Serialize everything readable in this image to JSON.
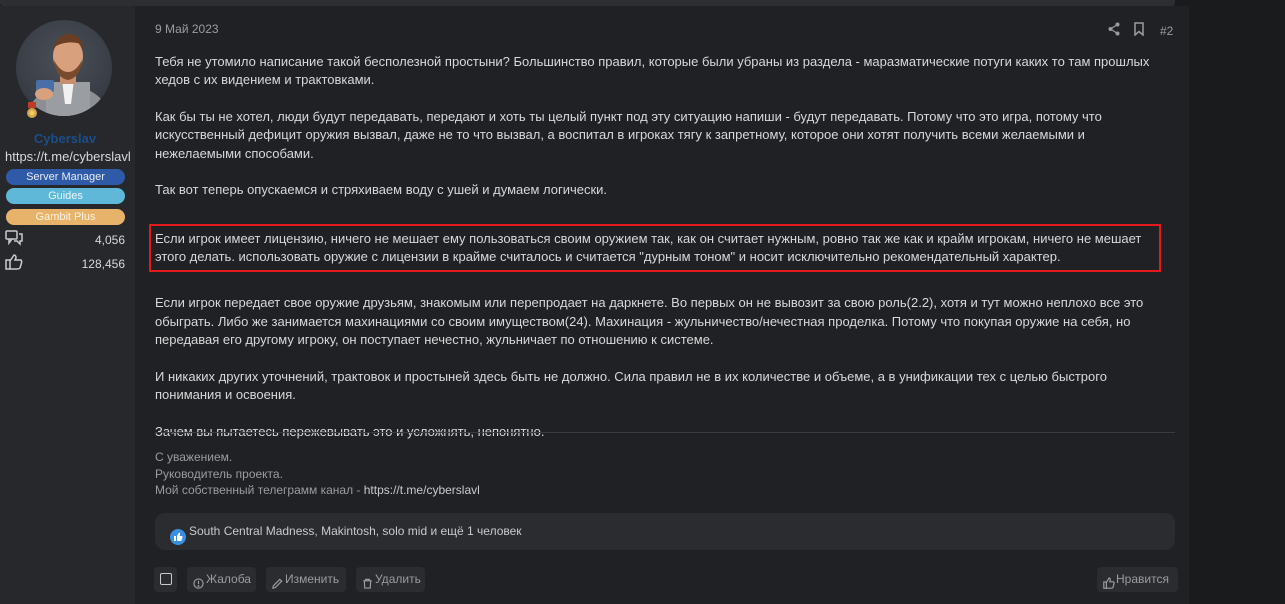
{
  "user": {
    "name": "Cyberslav",
    "link": "https://t.me/cyberslavl",
    "badges": [
      "Server Manager",
      "Guides",
      "Gambit Plus"
    ],
    "messages": "4,056",
    "reactions": "128,456"
  },
  "post": {
    "date": "9 Май 2023",
    "number": "#2",
    "paragraphs": [
      "Тебя не утомило написание такой бесполезной простыни? Большинство правил, которые были убраны из раздела - маразматические потуги каких то там прошлых хедов с их видением и трактовками.",
      "Как бы ты не хотел, люди будут передавать, передают и хоть ты целый пункт под эту ситуацию напиши - будут передавать. Потому что это игра, потому что искусственный дефицит оружия вызвал, даже не то что вызвал, а воспитал в игроках тягу к запретному, которое они хотят получить всеми желаемыми и нежелаемыми способами.",
      "Так вот теперь опускаемся и стряхиваем воду с ушей и думаем логически.",
      "Если игрок имеет лицензию, ничего не мешает ему пользоваться своим оружием так, как он считает нужным, ровно так же как и крайм игрокам, ничего не мешает этого делать. использовать оружие с лицензии в крайме считалось и считается \"дурным тоном\" и носит исключительно рекомендательный характер.",
      "Если игрок передает свое оружие друзьям, знакомым или перепродает на даркнете. Во первых он не вывозит за свою роль(2.2), хотя и тут можно неплохо все это обыграть. Либо же занимается махинациями со своим имуществом(24). Махинация - жульничество/нечестная проделка. Потому что покупая оружие на себя, но передавая его другому игроку, он поступает нечестно, жульничает по отношению к системе.",
      "И никаких других уточнений, трактовок и простыней здесь быть не должно. Сила правил не в их количестве и объеме, а в унификации тех с целью быстрого понимания и освоения.",
      "Зачем вы пытаетесь пережевывать это и усложнять, непонятно."
    ],
    "signature": {
      "line1": "С уважением.",
      "line2": "Руководитель проекта.",
      "line3_prefix": "Мой собственный телеграмм канал - ",
      "line3_link": "https://t.me/cyberslavl"
    },
    "reactions_text": "South Central Madness, Makintosh, solo mid и ещё 1 человек"
  },
  "actions": {
    "report": "Жалоба",
    "edit": "Изменить",
    "delete": "Удалить",
    "like": "Нравится"
  },
  "colors": {
    "highlight": "#e5191b",
    "username": "#1b4e8a",
    "badge_server_manager": "#2f5aa8",
    "badge_guides": "#5fb8d8",
    "badge_gambit_plus": "#e7b36a"
  }
}
